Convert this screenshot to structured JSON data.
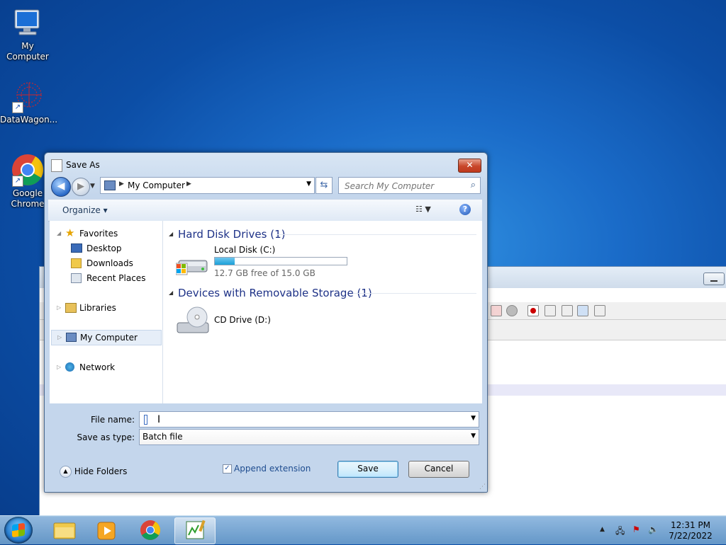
{
  "desktop": {
    "icons": [
      {
        "label": "My Computer"
      },
      {
        "label": "DataWagon..."
      },
      {
        "label": "Google Chrome"
      }
    ]
  },
  "dialog": {
    "title": "Save As",
    "address": {
      "location": "My Computer"
    },
    "search": {
      "placeholder": "Search My Computer"
    },
    "commandbar": {
      "organize": "Organize ▾"
    },
    "nav": {
      "favorites": "Favorites",
      "desktop": "Desktop",
      "downloads": "Downloads",
      "recent": "Recent Places",
      "libraries": "Libraries",
      "mycomputer": "My Computer",
      "network": "Network"
    },
    "groups": {
      "hdd": "Hard Disk Drives (1)",
      "removable": "Devices with Removable Storage (1)"
    },
    "drives": {
      "c_name": "Local Disk (C:)",
      "c_free": "12.7 GB free of 15.0 GB",
      "c_used_fraction": 0.153,
      "d_name": "CD Drive (D:)"
    },
    "form": {
      "filename_label": "File name:",
      "filename_value": "",
      "savetype_label": "Save as type:",
      "savetype_value": "Batch file"
    },
    "footer": {
      "hide_folders": "Hide Folders",
      "append_extension": "Append extension",
      "save": "Save",
      "cancel": "Cancel"
    }
  },
  "taskbar": {
    "time": "12:31 PM",
    "date": "7/22/2022"
  }
}
